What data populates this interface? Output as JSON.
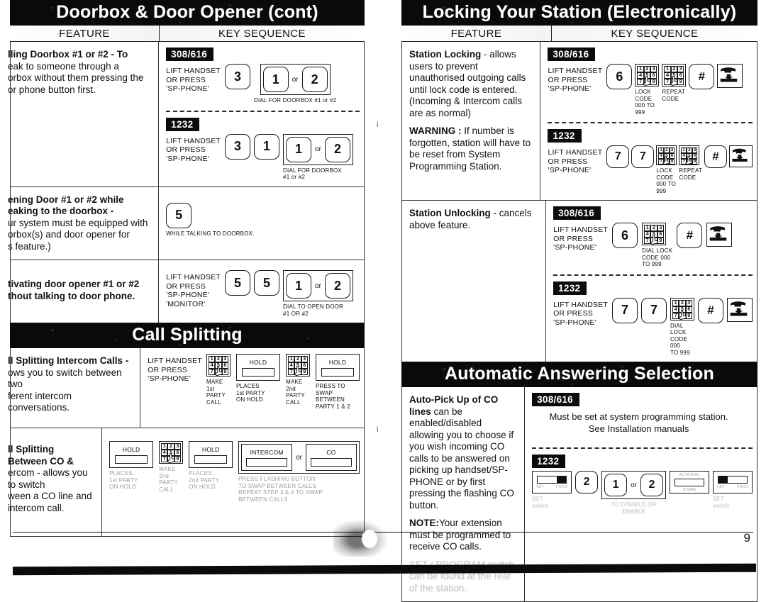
{
  "page": {
    "number": "9"
  },
  "left_column": {
    "sections": [
      {
        "id": "doorbox",
        "title": "Doorbox & Door Opener (cont)",
        "head": {
          "feature": "FEATURE",
          "key_sequence": "KEY SEQUENCE"
        },
        "rows": [
          {
            "feature_lines": [
              "lling Doorbox #1 or #2 - To",
              "eak to someone through a",
              "orbox without them pressing the",
              "or phone button first."
            ],
            "feature_bold_prefix": "lling Doorbox #1 or #2",
            "blocks": [
              {
                "model": "308/616",
                "lead": [
                  "LIFT HANDSET",
                  "OR PRESS",
                  "'SP-PHONE'"
                ],
                "keys": [
                  {
                    "type": "key",
                    "label": "3"
                  },
                  {
                    "type": "group",
                    "items": [
                      "1",
                      "or",
                      "2"
                    ],
                    "caption": "DIAL FOR DOORBOX #1 or #2"
                  }
                ]
              },
              {
                "model": "1232",
                "lead": [
                  "LIFT HANDSET",
                  "OR PRESS",
                  "'SP-PHONE'"
                ],
                "keys": [
                  {
                    "type": "key",
                    "label": "3"
                  },
                  {
                    "type": "key",
                    "label": "1"
                  },
                  {
                    "type": "group",
                    "items": [
                      "1",
                      "or",
                      "2"
                    ],
                    "caption": "DIAL FOR DOORBOX\n#1 or #2"
                  }
                ]
              }
            ]
          },
          {
            "feature_lines": [
              "ening Door #1 or #2  while",
              "eaking to the doorbox -",
              "ur system must be equipped with",
              "orbox(s) and door opener for",
              "s feature.)"
            ],
            "feature_bold_prefix": "ening Door #1 or #2  while eaking to the doorbox -",
            "blocks": [
              {
                "model": "",
                "lead": [],
                "keys": [
                  {
                    "type": "key",
                    "label": "5",
                    "caption": "WHILE TALKING TO DOORBOX."
                  }
                ]
              }
            ]
          },
          {
            "feature_lines": [
              "tivating door opener #1 or #2",
              "thout talking to door phone."
            ],
            "feature_bold_prefix": "tivating door opener #1 or #2 thout talking to door phone.",
            "blocks": [
              {
                "model": "",
                "lead": [
                  "LIFT HANDSET",
                  "OR PRESS",
                  "'SP-PHONE'",
                  "'MONITOR'"
                ],
                "keys": [
                  {
                    "type": "key",
                    "label": "5"
                  },
                  {
                    "type": "key",
                    "label": "5"
                  },
                  {
                    "type": "group",
                    "items": [
                      "1",
                      "or",
                      "2"
                    ],
                    "caption": "DIAL TO OPEN DOOR\n#1 OR #2"
                  }
                ]
              }
            ]
          }
        ]
      },
      {
        "id": "call-splitting",
        "title": "Call Splitting",
        "rows": [
          {
            "feature_lines": [
              "ll Splitting Intercom Calls -",
              "ows you to switch between two",
              "ferent intercom conversations."
            ],
            "feature_bold_prefix": "ll Splitting Intercom Calls -",
            "lead": [
              "LIFT HANDSET",
              "OR PRESS",
              "'SP-PHONE'"
            ],
            "steps": [
              {
                "glyph": "keypad",
                "caption": "MAKE\n1st PARTY\nCALL"
              },
              {
                "glyph": "hold",
                "label": "HOLD",
                "caption": "PLACES\n1st PARTY\nON HOLD"
              },
              {
                "glyph": "keypad",
                "caption": "MAKE\n2nd PARTY\nCALL"
              },
              {
                "glyph": "hold",
                "label": "HOLD",
                "caption": "PRESS TO\nSWAP\nBETWEEN\nPARTY 1 & 2"
              }
            ]
          },
          {
            "feature_lines": [
              "ll Splitting Between CO &",
              "ercom - allows you to switch",
              "ween a CO line and intercom call."
            ],
            "feature_bold_prefix": "ll Splitting Between CO &",
            "lead": [],
            "steps": [
              {
                "glyph": "hold",
                "label": "HOLD",
                "caption": "PLACES\n1st PARTY\nON HOLD"
              },
              {
                "glyph": "keypad",
                "caption": "MAKE\n2nd PARTY\nCALL"
              },
              {
                "glyph": "hold",
                "label": "HOLD",
                "caption": "PLACES\n2nd PARTY\nON HOLD"
              },
              {
                "glyph": "group2",
                "items": [
                  "INTERCOM",
                  "or",
                  "CO"
                ],
                "caption": "PRESS FLASHING BUTTON\nTO SWAP BETWEEN CALLS\nREPEAT STEP 3 & 4 TO SWAP\nBETWEEN CALLS"
              }
            ]
          }
        ]
      }
    ]
  },
  "right_column": {
    "sections": [
      {
        "id": "locking",
        "title": "Locking Your Station (Electronically)",
        "head": {
          "feature": "FEATURE",
          "key_sequence": "KEY SEQUENCE"
        },
        "rows": [
          {
            "feature_paragraphs": [
              {
                "bold": "Station Locking",
                "text": " - allows users to prevent unauthorised outgoing calls until lock code is entered.(Incoming & Intercom calls are as normal)"
              },
              {
                "bold": "WARNING :",
                "text": " If number is forgotten, station will have to be reset from System Programming Station."
              }
            ],
            "blocks": [
              {
                "model": "308/616",
                "lead": [
                  "LIFT HANDSET",
                  "OR PRESS",
                  "'SP-PHONE'"
                ],
                "keys": [
                  {
                    "type": "key",
                    "label": "6"
                  },
                  {
                    "type": "keypad",
                    "caption": "LOCK\nCODE\n000 TO\n999"
                  },
                  {
                    "type": "keypad",
                    "caption": "REPEAT\nCODE"
                  },
                  {
                    "type": "key",
                    "label": "#"
                  },
                  {
                    "type": "hangup"
                  }
                ]
              },
              {
                "model": "1232",
                "lead": [
                  "LIFT HANDSET",
                  "OR PRESS",
                  "'SP-PHONE'"
                ],
                "keys": [
                  {
                    "type": "key",
                    "label": "7"
                  },
                  {
                    "type": "key",
                    "label": "7"
                  },
                  {
                    "type": "keypad",
                    "caption": "LOCK\nCODE\n000 TO\n999"
                  },
                  {
                    "type": "keypad",
                    "caption": "REPEAT\nCODE"
                  },
                  {
                    "type": "key",
                    "label": "#"
                  },
                  {
                    "type": "hangup"
                  }
                ]
              }
            ]
          },
          {
            "feature_paragraphs": [
              {
                "bold": "Station Unlocking",
                "text": " - cancels above feature."
              }
            ],
            "blocks": [
              {
                "model": "308/616",
                "lead": [
                  "LIFT HANDSET",
                  "OR PRESS",
                  "'SP-PHONE'"
                ],
                "keys": [
                  {
                    "type": "key",
                    "label": "6"
                  },
                  {
                    "type": "keypad",
                    "caption": "DIAL LOCK\nCODE 000\nTO  999"
                  },
                  {
                    "type": "key",
                    "label": "#"
                  },
                  {
                    "type": "hangup"
                  }
                ]
              },
              {
                "model": "1232",
                "lead": [
                  "LIFT HANDSET",
                  "OR PRESS",
                  "'SP-PHONE'"
                ],
                "keys": [
                  {
                    "type": "key",
                    "label": "7"
                  },
                  {
                    "type": "key",
                    "label": "7"
                  },
                  {
                    "type": "keypad",
                    "caption": "DIAL LOCK\nCODE 000\nTO  999"
                  },
                  {
                    "type": "key",
                    "label": "#"
                  },
                  {
                    "type": "hangup"
                  }
                ]
              }
            ]
          }
        ]
      },
      {
        "id": "auto-answering",
        "title": "Automatic Answering Selection",
        "rows": [
          {
            "feature_paragraphs": [
              {
                "bold": "Auto-Pick Up of CO lines",
                "text": " can be enabled/disabled allowing you to choose if you wish incoming CO calls to be answered on picking up handset/SP-PHONE or by first pressing the flashing CO button."
              },
              {
                "bold": "NOTE:",
                "text": "Your extension must be programmed to receive CO calls."
              },
              {
                "bold": "",
                "text": "SET / PROGRAM switch can be found at the rear of the station.",
                "faded": true
              }
            ],
            "blocks": [
              {
                "model": "308/616",
                "note_lines": [
                  "Must be set at system programming station.",
                  "See Installation manuals"
                ]
              },
              {
                "model": "1232",
                "keys": [
                  {
                    "type": "switch",
                    "ends": [
                      "SET",
                      "PROG"
                    ],
                    "caption": "SET\nswitch"
                  },
                  {
                    "type": "key",
                    "label": "2"
                  },
                  {
                    "type": "group",
                    "items": [
                      "1",
                      "or",
                      "2"
                    ],
                    "caption": "TO DISABLE OR ENABLE"
                  },
                  {
                    "type": "autodial",
                    "label": "AUTODIAL",
                    "sub": "STORE"
                  },
                  {
                    "type": "switch",
                    "ends": [
                      "SET",
                      "PROG"
                    ],
                    "caption": "SET\nswitch"
                  }
                ]
              }
            ]
          }
        ]
      }
    ]
  }
}
